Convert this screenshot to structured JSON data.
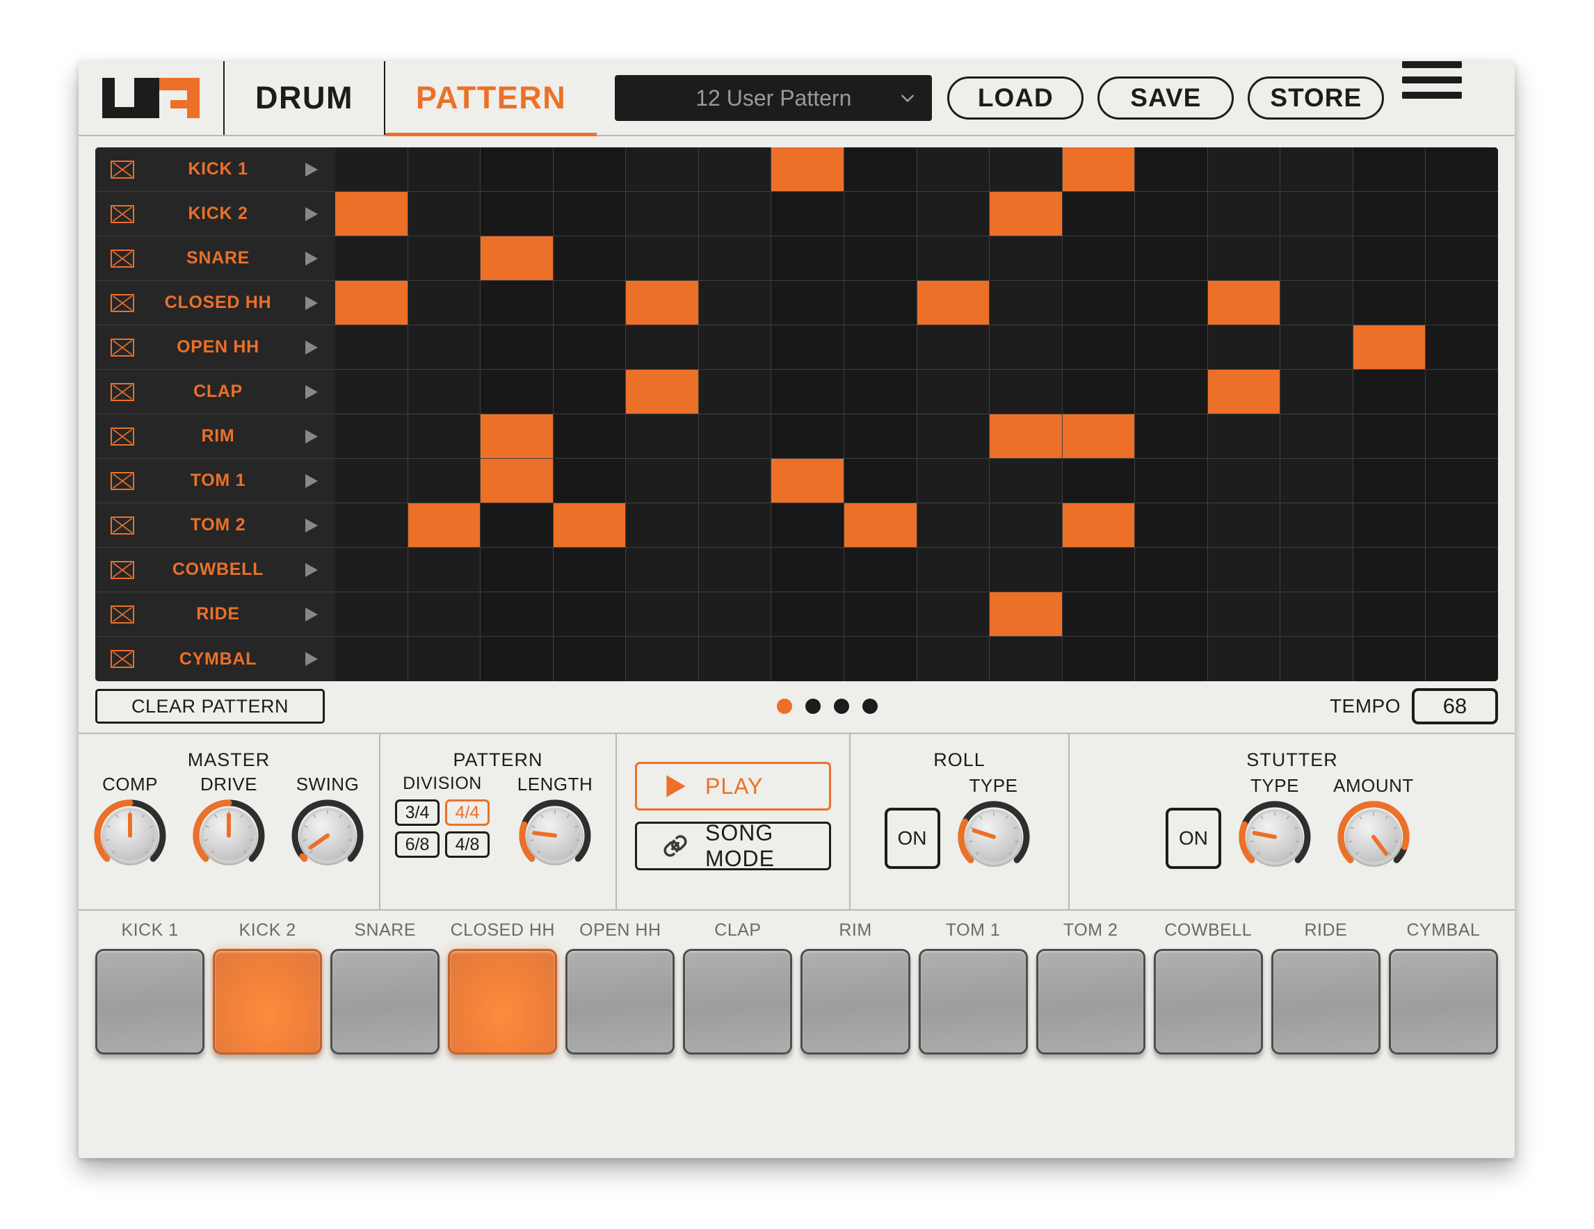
{
  "header": {
    "logo_name": "uno-logo",
    "tab_drum": "DRUM",
    "tab_pattern": "PATTERN",
    "pattern_select_value": "12 User Pattern",
    "chevron_icon": "chevron-down-icon",
    "load_label": "LOAD",
    "save_label": "SAVE",
    "store_label": "STORE",
    "menu_icon": "hamburger-menu-icon"
  },
  "sequencer": {
    "steps": 16,
    "mute_icon": "mute-crossbox-icon",
    "audition_icon": "play-triangle-icon",
    "tracks": [
      {
        "name": "KICK 1",
        "steps": [
          0,
          0,
          0,
          0,
          0,
          0,
          1,
          0,
          0,
          0,
          1,
          0,
          0,
          0,
          0,
          0
        ]
      },
      {
        "name": "KICK 2",
        "steps": [
          1,
          0,
          0,
          0,
          0,
          0,
          0,
          0,
          0,
          1,
          0,
          0,
          0,
          0,
          0,
          0
        ]
      },
      {
        "name": "SNARE",
        "steps": [
          0,
          0,
          1,
          0,
          0,
          0,
          0,
          0,
          0,
          0,
          0,
          0,
          0,
          0,
          0,
          0
        ]
      },
      {
        "name": "CLOSED HH",
        "steps": [
          1,
          0,
          0,
          0,
          1,
          0,
          0,
          0,
          1,
          0,
          0,
          0,
          1,
          0,
          0,
          0
        ]
      },
      {
        "name": "OPEN HH",
        "steps": [
          0,
          0,
          0,
          0,
          0,
          0,
          0,
          0,
          0,
          0,
          0,
          0,
          0,
          0,
          1,
          0
        ]
      },
      {
        "name": "CLAP",
        "steps": [
          0,
          0,
          0,
          0,
          1,
          0,
          0,
          0,
          0,
          0,
          0,
          0,
          1,
          0,
          0,
          0
        ]
      },
      {
        "name": "RIM",
        "steps": [
          0,
          0,
          1,
          0,
          0,
          0,
          0,
          0,
          0,
          1,
          1,
          0,
          0,
          0,
          0,
          0
        ]
      },
      {
        "name": "TOM 1",
        "steps": [
          0,
          0,
          1,
          0,
          0,
          0,
          1,
          0,
          0,
          0,
          0,
          0,
          0,
          0,
          0,
          0
        ]
      },
      {
        "name": "TOM 2",
        "steps": [
          0,
          1,
          0,
          1,
          0,
          0,
          0,
          1,
          0,
          0,
          1,
          0,
          0,
          0,
          0,
          0
        ]
      },
      {
        "name": "COWBELL",
        "steps": [
          0,
          0,
          0,
          0,
          0,
          0,
          0,
          0,
          0,
          0,
          0,
          0,
          0,
          0,
          0,
          0
        ]
      },
      {
        "name": "RIDE",
        "steps": [
          0,
          0,
          0,
          0,
          0,
          0,
          0,
          0,
          0,
          1,
          0,
          0,
          0,
          0,
          0,
          0
        ]
      },
      {
        "name": "CYMBAL",
        "steps": [
          0,
          0,
          0,
          0,
          0,
          0,
          0,
          0,
          0,
          0,
          0,
          0,
          0,
          0,
          0,
          0
        ]
      }
    ]
  },
  "underbar": {
    "clear_label": "CLEAR PATTERN",
    "page_dots": 4,
    "page_active_index": 0,
    "tempo_label": "TEMPO",
    "tempo_value": "68"
  },
  "master": {
    "title": "MASTER",
    "knobs": [
      {
        "label": "COMP",
        "angle": 0,
        "arc": 0.5
      },
      {
        "label": "DRIVE",
        "angle": 0,
        "arc": 0.5
      },
      {
        "label": "SWING",
        "angle": -125,
        "arc": 0.02
      }
    ]
  },
  "pattern": {
    "title": "PATTERN",
    "division_label": "DIVISION",
    "divisions": [
      "3/4",
      "4/4",
      "6/8",
      "4/8"
    ],
    "division_active": "4/4",
    "length": {
      "label": "LENGTH",
      "angle": -83,
      "arc": 0.24
    }
  },
  "transport": {
    "play_label": "PLAY",
    "play_icon": "play-triangle-icon",
    "song_mode_label": "SONG MODE",
    "song_mode_icon": "link-chain-icon"
  },
  "roll": {
    "title": "ROLL",
    "on_label": "ON",
    "type": {
      "label": "TYPE",
      "angle": -72,
      "arc": 0.27
    }
  },
  "stutter": {
    "title": "STUTTER",
    "on_label": "ON",
    "type": {
      "label": "TYPE",
      "angle": -79,
      "arc": 0.25
    },
    "amount": {
      "label": "AMOUNT",
      "angle": 143,
      "arc": 0.9
    }
  },
  "pads": [
    {
      "label": "KICK 1",
      "lit": false
    },
    {
      "label": "KICK 2",
      "lit": true
    },
    {
      "label": "SNARE",
      "lit": false
    },
    {
      "label": "CLOSED HH",
      "lit": true
    },
    {
      "label": "OPEN HH",
      "lit": false
    },
    {
      "label": "CLAP",
      "lit": false
    },
    {
      "label": "RIM",
      "lit": false
    },
    {
      "label": "TOM 1",
      "lit": false
    },
    {
      "label": "TOM 2",
      "lit": false
    },
    {
      "label": "COWBELL",
      "lit": false
    },
    {
      "label": "RIDE",
      "lit": false
    },
    {
      "label": "CYMBAL",
      "lit": false
    }
  ],
  "colors": {
    "accent": "#ec7028",
    "panel": "#eeeeea",
    "ink": "#1c1c1c",
    "grid_cell": "#181818",
    "grid_cell_alt": "#1d1d1d"
  }
}
